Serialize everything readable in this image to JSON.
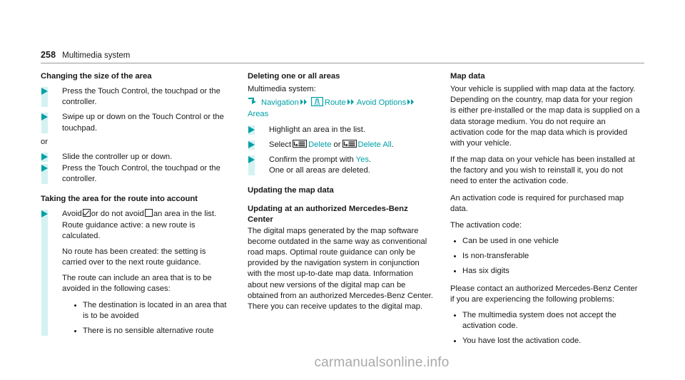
{
  "header": {
    "page_number": "258",
    "chapter": "Multimedia system"
  },
  "colors": {
    "accent_teal": "#00a0a6",
    "rail_cyan": "#d4f2f2",
    "text": "#1a1a1a",
    "watermark": "#a9a9a9"
  },
  "left_column": {
    "section1_title": "Changing the size of the area",
    "step1": "Press the Touch Control, the touchpad or the controller.",
    "step2": "Swipe up or down on the Touch Control or the touchpad.",
    "or": "or",
    "step3": "Slide the controller up or down.",
    "step4": "Press the Touch Control, the touchpad or the controller.",
    "section2_title": "Taking the area for the route into account",
    "avoid_step": {
      "part1": "Avoid",
      "part2": "or do not avoid",
      "part3": "an area in the list.",
      "icon_checked": "checkbox-checked-icon",
      "icon_unchecked": "checkbox-unchecked-icon"
    },
    "avoid_para1": "Route guidance active: a new route is calculated.",
    "avoid_para2": "No route has been created: the setting is carried over to the next route guidance.",
    "avoid_para3": "The route can include an area that is to be avoided in the following cases:",
    "avoid_bullets": [
      "The destination is located in an area that is to be avoided",
      "There is no sensible alternative route"
    ]
  },
  "middle_column": {
    "section1_title": "Deleting one or all areas",
    "system_label": "Multimedia system:",
    "breadcrumb": {
      "turn_arrow_icon": "turn-arrow-icon",
      "item1": "Navigation",
      "route_icon": "route-sign-icon",
      "item2": "Route",
      "item3": "Avoid Options",
      "item4": "Areas",
      "separator_icon": "double-chevron-icon"
    },
    "step1": "Highlight an area in the list.",
    "step2": {
      "prefix": "Select",
      "delete_label": "Delete",
      "or": "or",
      "delete_all_label": "Delete All",
      "suffix": ".",
      "icon": "list-select-icon"
    },
    "step3": {
      "prefix": "Confirm the prompt with",
      "yes_label": "Yes",
      "suffix": ".",
      "note": "One or all areas are deleted."
    },
    "section2_title": "Updating the map data",
    "subsection_title": "Updating at an authorized Mercedes-Benz Center",
    "body": "The digital maps generated by the map software become outdated in the same way as conventional road maps. Optimal route guidance can only be provided by the navigation system in conjunction with the most up-to-date map data. Information about new versions of the digital map can be obtained from an authorized Mercedes-Benz Center. There you can receive updates to the digital map."
  },
  "right_column": {
    "section_title": "Map data",
    "para1": "Your vehicle is supplied with map data at the factory. Depending on the country, map data for your region is either pre-installed or the map data is supplied on a data storage medium. You do not require an activation code for the map data which is provided with your vehicle.",
    "para2": "If the map data on your vehicle has been installed at the factory and you wish to reinstall it, you do not need to enter the activation code.",
    "para3": "An activation code is required for purchased map data.",
    "para4": "The activation code:",
    "bullets1": [
      "Can be used in one vehicle",
      "Is non-transferable",
      "Has six digits"
    ],
    "para5": "Please contact an authorized Mercedes-Benz Center if you are experiencing the following problems:",
    "bullets2": [
      "The multimedia system does not accept the activation code.",
      "You have lost the activation code."
    ]
  },
  "watermark": "carmanualsonline.info"
}
